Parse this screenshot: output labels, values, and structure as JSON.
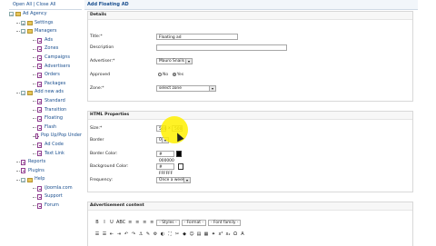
{
  "sidebar": {
    "top_links": "Open All | Close All",
    "items": [
      {
        "label": "Ad Agency",
        "level": 0,
        "kind": "root"
      },
      {
        "label": "Settings",
        "level": 1,
        "kind": "folder"
      },
      {
        "label": "Managers",
        "level": 1,
        "kind": "folder"
      },
      {
        "label": "Ads",
        "level": 2,
        "kind": "doc"
      },
      {
        "label": "Zones",
        "level": 2,
        "kind": "doc"
      },
      {
        "label": "Campaigns",
        "level": 2,
        "kind": "doc"
      },
      {
        "label": "Advertisers",
        "level": 2,
        "kind": "doc"
      },
      {
        "label": "Orders",
        "level": 2,
        "kind": "doc"
      },
      {
        "label": "Packages",
        "level": 2,
        "kind": "doc"
      },
      {
        "label": "Add new ads",
        "level": 1,
        "kind": "folder"
      },
      {
        "label": "Standard",
        "level": 2,
        "kind": "doc"
      },
      {
        "label": "Transition",
        "level": 2,
        "kind": "doc"
      },
      {
        "label": "Floating",
        "level": 2,
        "kind": "doc"
      },
      {
        "label": "Flash",
        "level": 2,
        "kind": "doc"
      },
      {
        "label": "Pop Up/Pop Under",
        "level": 2,
        "kind": "doc"
      },
      {
        "label": "Ad Code",
        "level": 2,
        "kind": "doc"
      },
      {
        "label": "Text Link",
        "level": 2,
        "kind": "doc"
      },
      {
        "label": "Reports",
        "level": 1,
        "kind": "doc"
      },
      {
        "label": "Plugins",
        "level": 1,
        "kind": "doc"
      },
      {
        "label": "Help",
        "level": 1,
        "kind": "folder"
      },
      {
        "label": "iJoomla.com",
        "level": 2,
        "kind": "doc"
      },
      {
        "label": "Support",
        "level": 2,
        "kind": "doc"
      },
      {
        "label": "Forum",
        "level": 2,
        "kind": "doc"
      }
    ]
  },
  "main": {
    "header": "Add Floating AD",
    "details": {
      "title": "Details",
      "title_label": "Title:*",
      "title_value": "Floating ad",
      "description_label": "Description",
      "description_value": "",
      "advertiser_label": "Advertiser:*",
      "advertiser_value": "Mauro Snails",
      "approved_label": "Approved",
      "approved_no": "No",
      "approved_yes": "Yes",
      "zone_label": "Zone:*",
      "zone_value": "select zone"
    },
    "html_props": {
      "title": "HTML Properties",
      "size_label": "Size:*",
      "size_w": "500",
      "size_sep": "x",
      "size_h": "500",
      "border_label": "Border",
      "border_value": "0",
      "border_color_label": "Border Color:",
      "border_color_value": "# 000000",
      "border_color_swatch": "#000000",
      "bg_color_label": "Background Color:",
      "bg_color_value": "# FFFFFF",
      "bg_color_swatch": "#FFFFFF",
      "frequency_label": "Frequency:",
      "frequency_value": "Once a week"
    },
    "content": {
      "title": "Advertisement content",
      "toolbar1": [
        "B",
        "I",
        "U",
        "ABC",
        "≡",
        "≡",
        "≡",
        "≡"
      ],
      "styles": "- Styles -",
      "format": "- Format -",
      "font_family": "- Font family -",
      "toolbar2": [
        "☰",
        "☰",
        "⇤",
        "⇥",
        "↶",
        "↷",
        "⚓",
        "✎",
        "⚙",
        "◐",
        "⛶",
        "✂",
        "◆",
        "☺",
        "▤",
        "▦",
        "✦",
        "x²",
        "x₂",
        "Ω",
        "A"
      ]
    }
  }
}
